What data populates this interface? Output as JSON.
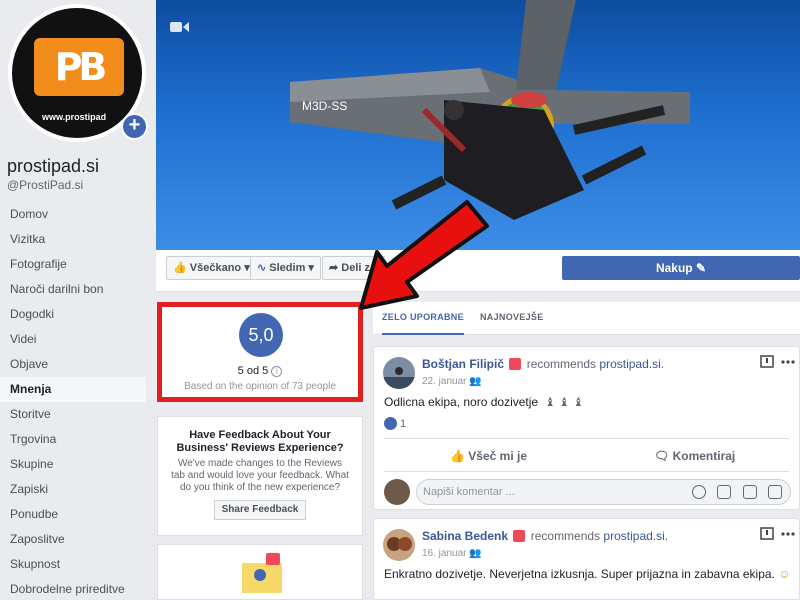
{
  "page": {
    "name": "prostipad.si",
    "handle": "@ProstiPad.si",
    "logo_url_text": "www.prostipad",
    "logo_letters": "PB"
  },
  "sidebar": {
    "items": [
      {
        "label": "Domov",
        "active": false
      },
      {
        "label": "Vizitka",
        "active": false
      },
      {
        "label": "Fotografije",
        "active": false
      },
      {
        "label": "Naroči darilni bon",
        "active": false
      },
      {
        "label": "Dogodki",
        "active": false
      },
      {
        "label": "Videi",
        "active": false
      },
      {
        "label": "Objave",
        "active": false
      },
      {
        "label": "Mnenja",
        "active": true
      },
      {
        "label": "Storitve",
        "active": false
      },
      {
        "label": "Trgovina",
        "active": false
      },
      {
        "label": "Skupine",
        "active": false
      },
      {
        "label": "Zapiski",
        "active": false
      },
      {
        "label": "Ponudbe",
        "active": false
      },
      {
        "label": "Zaposlitve",
        "active": false
      },
      {
        "label": "Skupnost",
        "active": false
      },
      {
        "label": "Dobrodelne prireditve",
        "active": false
      }
    ]
  },
  "actionbar": {
    "liked": "Všečkano",
    "follow": "Sledim",
    "share": "Deli z dr",
    "buy": "Nakup"
  },
  "rating": {
    "score": "5,0",
    "out_of": "5 od 5",
    "based_on": "Based on the opinion of 73 people"
  },
  "feedback": {
    "title": "Have Feedback About Your Business' Reviews Experience?",
    "body": "We've made changes to the Reviews tab and would love your feedback. What do you think of the new experience?",
    "button": "Share Feedback"
  },
  "tabs": [
    {
      "label": "ZELO UPORABNE",
      "active": true
    },
    {
      "label": "NAJNOVEJŠE",
      "active": false
    }
  ],
  "posts": [
    {
      "author": "Boštjan Filipič",
      "recommends": "recommends",
      "target": "prostipad.si.",
      "date": "22. januar",
      "text": "Odlicna ekipa, noro dozivetje",
      "likes": "1",
      "like_label": "Všeč mi je",
      "comment_label": "Komentiraj",
      "comment_placeholder": "Napiši komentar ..."
    },
    {
      "author": "Sabina Bedenk",
      "recommends": "recommends",
      "target": "prostipad.si.",
      "date": "16. januar",
      "text": "Enkratno dozivetje. Neverjetna izkusnja. Super prijazna in zabavna ekipa."
    }
  ],
  "colors": {
    "brand_blue": "#4267b2",
    "highlight_red": "#e02020",
    "logo_orange": "#f28c1a"
  }
}
